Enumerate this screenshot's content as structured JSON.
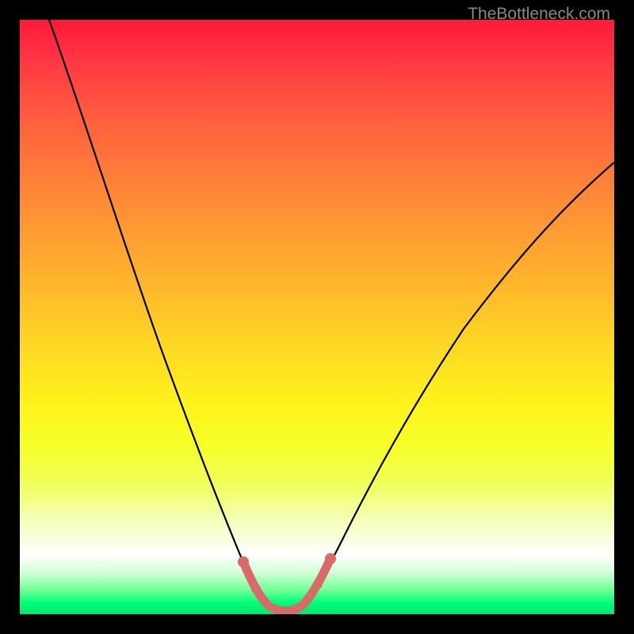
{
  "watermark": "TheBottleneck.com",
  "chart_data": {
    "type": "line",
    "title": "",
    "xlabel": "",
    "ylabel": "",
    "xlim": [
      0,
      100
    ],
    "ylim": [
      0,
      100
    ],
    "description": "Bottleneck curve with rainbow gradient background where the minimum touches the bottom green zone around x=40-47% indicating optimal hardware balance; values rise toward red at the extremes.",
    "series": [
      {
        "name": "bottleneck-curve",
        "x": [
          5,
          10,
          15,
          20,
          25,
          30,
          35,
          38,
          40,
          42,
          44,
          46,
          48,
          50,
          55,
          60,
          65,
          70,
          75,
          80,
          85,
          90,
          95,
          100
        ],
        "y": [
          100,
          88,
          76,
          64,
          52,
          40,
          26,
          14,
          4,
          0.5,
          0,
          0.5,
          4,
          11,
          22,
          31,
          39,
          46,
          52,
          58,
          63,
          68,
          72,
          76
        ]
      },
      {
        "name": "highlight-segment",
        "x": [
          38,
          40,
          42,
          44,
          46,
          48
        ],
        "y": [
          6,
          2,
          0.5,
          0.5,
          2,
          6
        ]
      }
    ],
    "gradient_stops": [
      {
        "pos": 0,
        "color": "#ff1a3a"
      },
      {
        "pos": 50,
        "color": "#fff000"
      },
      {
        "pos": 90,
        "color": "#ffffff"
      },
      {
        "pos": 100,
        "color": "#00e870"
      }
    ]
  }
}
